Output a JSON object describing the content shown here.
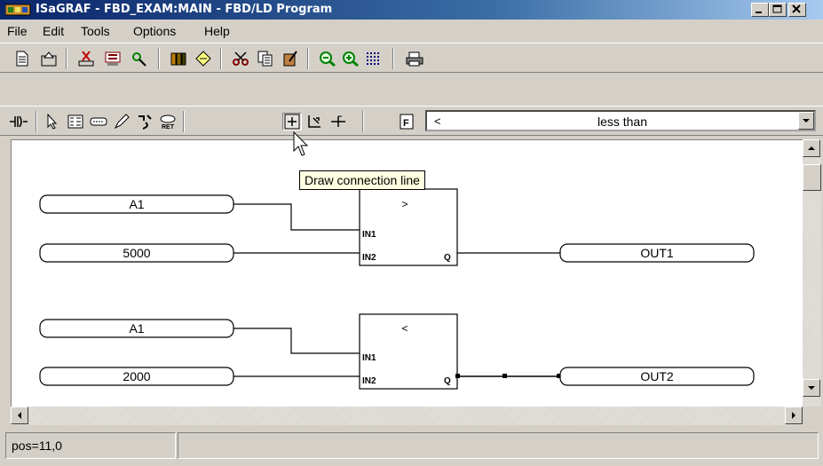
{
  "window": {
    "title": "ISaGRAF - FBD_EXAM:MAIN - FBD/LD Program",
    "icon": "isagraf-app-icon",
    "controls": {
      "minimize": "_",
      "maximize": "□",
      "close": "×"
    }
  },
  "menu": [
    {
      "label": "File"
    },
    {
      "label": "Edit"
    },
    {
      "label": "Tools"
    },
    {
      "label": "Options"
    },
    {
      "label": "Help"
    }
  ],
  "toolbar1": [
    {
      "name": "new-document-icon",
      "glyph": "🗋"
    },
    {
      "name": "save-document-icon",
      "glyph": "🗎"
    },
    {
      "name": "cut-box-icon",
      "glyph": "✂"
    },
    {
      "name": "variables-icon",
      "glyph": "▦"
    },
    {
      "name": "check-icon",
      "glyph": "⚲"
    },
    {
      "name": "library-icon",
      "glyph": "▥"
    },
    {
      "name": "compile-icon",
      "glyph": "⚙"
    },
    {
      "name": "cut-icon",
      "glyph": "✂"
    },
    {
      "name": "copy-icon",
      "glyph": "⧉"
    },
    {
      "name": "paste-icon",
      "glyph": "✎"
    },
    {
      "name": "zoom-out-icon",
      "glyph": "⊖"
    },
    {
      "name": "zoom-in-icon",
      "glyph": "⊕"
    },
    {
      "name": "grid-icon",
      "glyph": "⠿"
    },
    {
      "name": "print-icon",
      "glyph": "⎙"
    }
  ],
  "toolbar2": [
    {
      "name": "ld-contact-icon",
      "glyph": "┤├"
    },
    {
      "name": "select-pointer-icon",
      "glyph": "↖"
    },
    {
      "name": "function-block-icon",
      "glyph": "▤"
    },
    {
      "name": "variable-box-icon",
      "glyph": "▭"
    },
    {
      "name": "comment-icon",
      "glyph": "✐"
    },
    {
      "name": "jump-icon",
      "glyph": "↯"
    },
    {
      "name": "return-icon",
      "glyph": "⏎"
    },
    {
      "name": "connection-line-icon",
      "glyph": "⊞"
    },
    {
      "name": "corner-icon",
      "glyph": "⇱"
    },
    {
      "name": "arc-icon",
      "glyph": "⊣"
    },
    {
      "name": "function-list-icon",
      "glyph": "F"
    }
  ],
  "function_combo": {
    "symbol": "<",
    "description": "less than"
  },
  "tooltip": "Draw connection line",
  "diagram": {
    "rung1": {
      "input1": "A1",
      "input2": "5000",
      "block_symbol": ">",
      "pin_in1": "IN1",
      "pin_in2": "IN2",
      "pin_out": "Q",
      "output": "OUT1"
    },
    "rung2": {
      "input1": "A1",
      "input2": "2000",
      "block_symbol": "<",
      "pin_in1": "IN1",
      "pin_in2": "IN2",
      "pin_out": "Q",
      "output": "OUT2"
    }
  },
  "status": {
    "position": "pos=11,0",
    "message": ""
  }
}
